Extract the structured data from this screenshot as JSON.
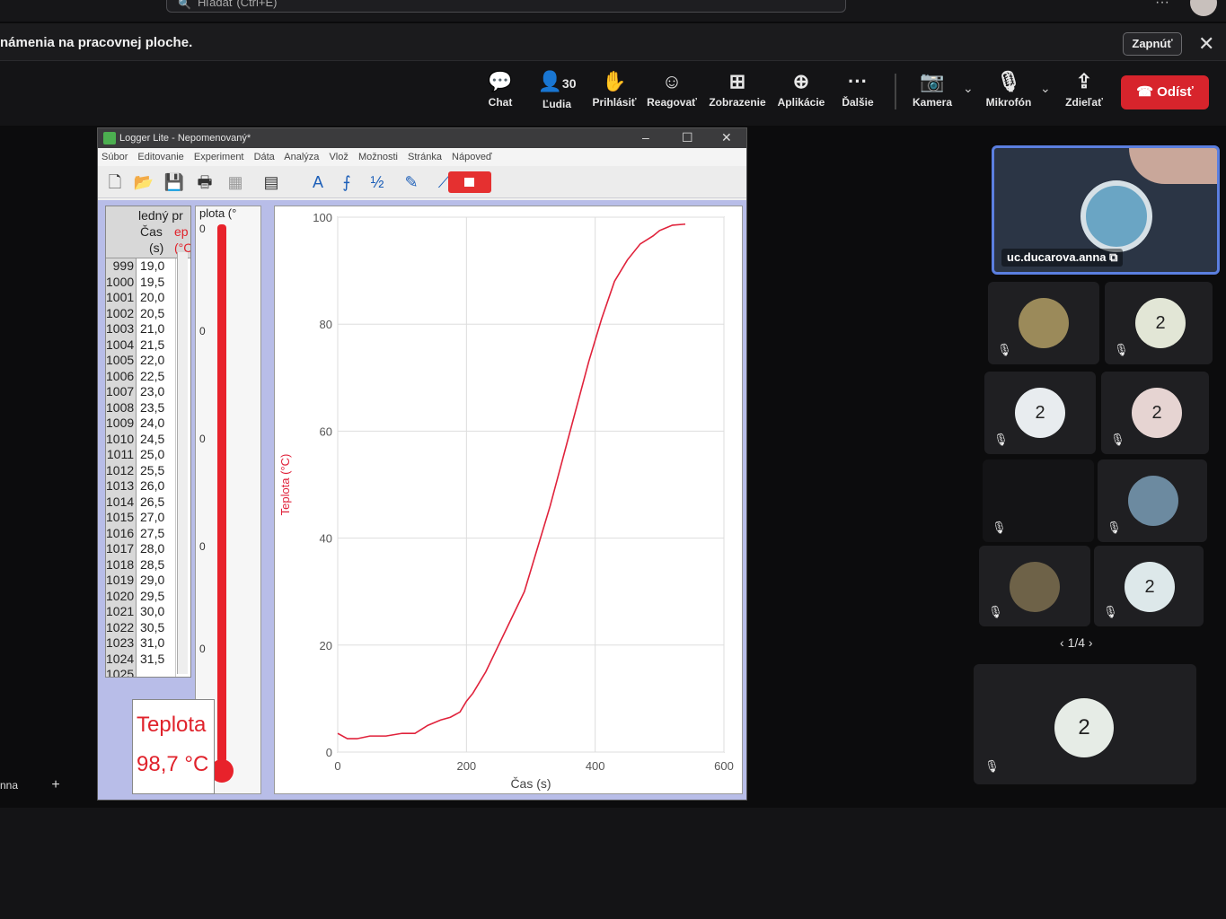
{
  "top": {
    "search_placeholder": "Hľadať (Ctrl+E)"
  },
  "notification": {
    "text": "námenia na pracovnej ploche.",
    "on_button": "Zapnúť"
  },
  "toolbar": {
    "chat": "Chat",
    "people": "Ľudia",
    "people_count": "30",
    "raise": "Prihlásiť",
    "react": "Reagovať",
    "view": "Zobrazenie",
    "apps": "Aplikácie",
    "more": "Ďalšie",
    "camera": "Kamera",
    "mic": "Mikrofón",
    "share": "Zdieľať",
    "leave": "Odísť"
  },
  "logger": {
    "title": "Logger Lite - Nepomenovaný*",
    "menu": [
      "Súbor",
      "Editovanie",
      "Experiment",
      "Dáta",
      "Analýza",
      "Vlož",
      "Možnosti",
      "Stránka",
      "Nápoveď"
    ],
    "table": {
      "col_header_top": "ledný pr",
      "col_time": "Čas",
      "col_time_unit": "(s)",
      "col_temp": "ep",
      "col_temp_unit": "(°C",
      "rows": [
        [
          "999",
          "19,0"
        ],
        [
          "1000",
          "19,5"
        ],
        [
          "1001",
          "20,0"
        ],
        [
          "1002",
          "20,5"
        ],
        [
          "1003",
          "21,0"
        ],
        [
          "1004",
          "21,5"
        ],
        [
          "1005",
          "22,0"
        ],
        [
          "1006",
          "22,5"
        ],
        [
          "1007",
          "23,0"
        ],
        [
          "1008",
          "23,5"
        ],
        [
          "1009",
          "24,0"
        ],
        [
          "1010",
          "24,5"
        ],
        [
          "1011",
          "25,0"
        ],
        [
          "1012",
          "25,5"
        ],
        [
          "1013",
          "26,0"
        ],
        [
          "1014",
          "26,5"
        ],
        [
          "1015",
          "27,0"
        ],
        [
          "1016",
          "27,5"
        ],
        [
          "1017",
          "28,0"
        ],
        [
          "1018",
          "28,5"
        ],
        [
          "1019",
          "29,0"
        ],
        [
          "1020",
          "29,5"
        ],
        [
          "1021",
          "30,0"
        ],
        [
          "1022",
          "30,5"
        ],
        [
          "1023",
          "31,0"
        ],
        [
          "1024",
          "31,5"
        ],
        [
          "1025",
          ""
        ]
      ]
    },
    "thermometer": {
      "header": "plota (°",
      "ticks": [
        "0",
        "0",
        "0",
        "0",
        "0",
        "0"
      ]
    },
    "readout": {
      "label": "Teplota",
      "value": "98,7 °C"
    }
  },
  "participants": {
    "main_name": "uc.ducarova.anna",
    "tiles": [
      "2",
      "2",
      "2",
      "2",
      "2",
      "2"
    ],
    "pager": "1/4"
  },
  "taskbar": {
    "tab": "nna"
  },
  "chart_data": {
    "type": "line",
    "xlabel": "Čas (s)",
    "ylabel": "Teplota (°C)",
    "xlim": [
      0,
      600
    ],
    "ylim": [
      0,
      100
    ],
    "xticks": [
      0,
      200,
      400,
      600
    ],
    "yticks": [
      0,
      20,
      40,
      60,
      80,
      100
    ],
    "grid": true,
    "color": "#e0223b",
    "series": [
      {
        "x": [
          0,
          15,
          30,
          50,
          75,
          100,
          120,
          140,
          160,
          175,
          190,
          200,
          210,
          230,
          250,
          270,
          290,
          310,
          330,
          350,
          370,
          390,
          410,
          430,
          450,
          470,
          490,
          500,
          520,
          540
        ],
        "values": [
          3.5,
          2.5,
          2.5,
          3,
          3,
          3.5,
          3.5,
          5,
          6,
          6.5,
          7.5,
          9.5,
          11,
          15,
          20,
          25,
          30,
          38,
          46,
          55,
          64,
          73,
          81,
          88,
          92,
          95,
          96.5,
          97.5,
          98.5,
          98.7
        ]
      }
    ]
  }
}
